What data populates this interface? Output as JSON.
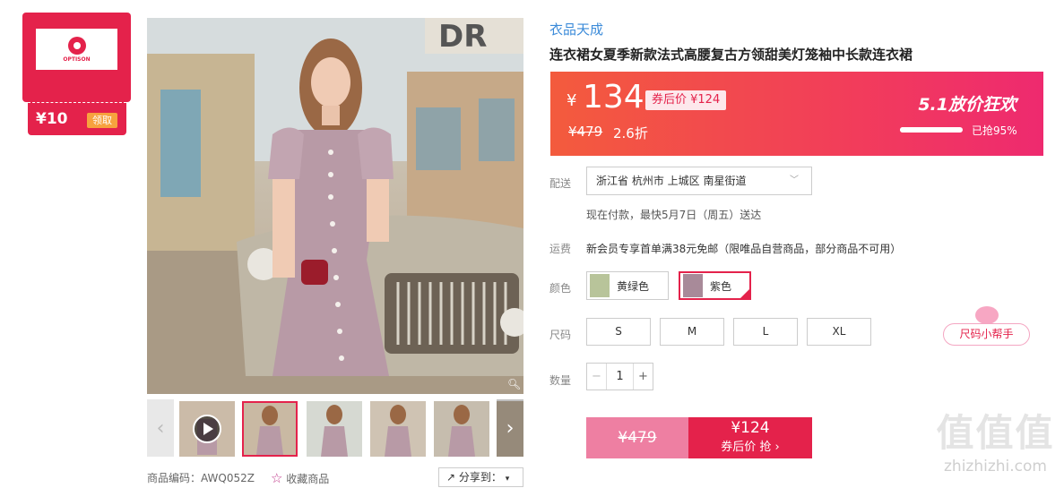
{
  "coupon": {
    "amount": "¥10",
    "claim_label": "领取",
    "brand_logo_text": "OPTISON"
  },
  "product": {
    "brand": "衣品天成",
    "title": "连衣裙女夏季新款法式高腰复古方领甜美灯笼袖中长款连衣裙",
    "code_label": "商品编码：AWQ052Z",
    "favorite_label": "收藏商品",
    "share_label": "分享到："
  },
  "price": {
    "currency": "¥",
    "current": "134",
    "after_coupon": "券后价 ¥124",
    "original": "¥479",
    "discount": "2.6折",
    "promo": "5.1放价狂欢",
    "sold_label": "已抢95%",
    "sold_fraction": 0.95
  },
  "shipping": {
    "label": "配送",
    "address": "浙江省 杭州市 上城区 南星街道",
    "eta": "现在付款，最快5月7日（周五）送达"
  },
  "freight": {
    "label": "运费",
    "text": "新会员专享首单满38元免邮（限唯品自营商品，部分商品不可用）"
  },
  "colors": {
    "label": "颜色",
    "options": [
      {
        "name": "黄绿色",
        "swatch": "#b8c49a"
      },
      {
        "name": "紫色",
        "swatch": "#a88a99"
      }
    ],
    "selected": "紫色"
  },
  "sizes": {
    "label": "尺码",
    "options": [
      "S",
      "M",
      "L",
      "XL"
    ],
    "helper": "尺码小帮手"
  },
  "quantity": {
    "label": "数量",
    "value": "1",
    "minus": "−",
    "plus": "+"
  },
  "buy": {
    "original": "¥479",
    "price": "¥124",
    "action": "券后价 抢 ›"
  },
  "watermark": {
    "text": "值值值",
    "domain": "zhizhizhi.com"
  },
  "colors_theme": {
    "accent": "#e4224b",
    "brand_blue": "#3c8bd9"
  }
}
